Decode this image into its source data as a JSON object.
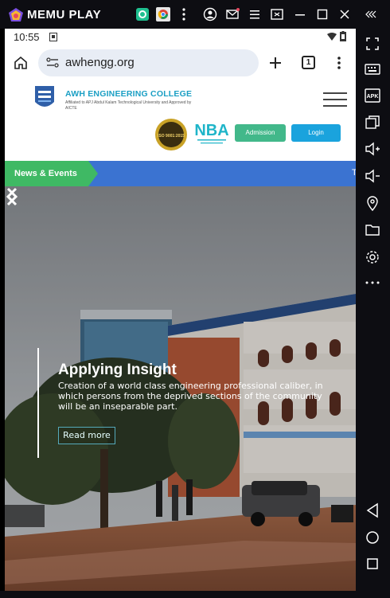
{
  "emulator": {
    "title": "MEMU PLAY",
    "toolbar_icons": [
      "app-icon",
      "chrome-icon",
      "more-vert-icon",
      "account-icon",
      "mail-icon",
      "menu-icon",
      "screenshot-icon",
      "minimize-icon",
      "maximize-icon",
      "close-icon",
      "collapse-icon"
    ],
    "side_icons": [
      "fullscreen-icon",
      "keyboard-icon",
      "apk-icon",
      "multi-window-icon",
      "volume-up-icon",
      "volume-down-icon",
      "location-icon",
      "folder-icon",
      "settings-icon",
      "more-horiz-icon",
      "back-icon",
      "home-icon",
      "recents-icon"
    ],
    "apk_label": "APK"
  },
  "status": {
    "time": "10:55"
  },
  "browser": {
    "url": "awhengg.org",
    "tab_count": "1"
  },
  "site": {
    "college_name": "AWH ENGINEERING COLLEGE",
    "college_sub": "Affiliated to APJ Abdul Kalam Technological University and Approved by AICTE",
    "iso_text": "ISO 9001:2015",
    "nba_text": "NBA",
    "admission_label": "Admission",
    "login_label": "Login",
    "news_label": "News & Events",
    "news_tick": "T"
  },
  "hero": {
    "title": "Applying Insight",
    "text": "Creation of a world class engineering professional caliber, in which persons from the deprived sections of the community will be an inseparable part.",
    "read_more": "Read more"
  },
  "colors": {
    "accent_green": "#42b88a",
    "accent_blue": "#1aa3dd",
    "news_green": "#3fb964",
    "news_blue": "#3b73d1",
    "title_blue": "#1b9fc4"
  }
}
